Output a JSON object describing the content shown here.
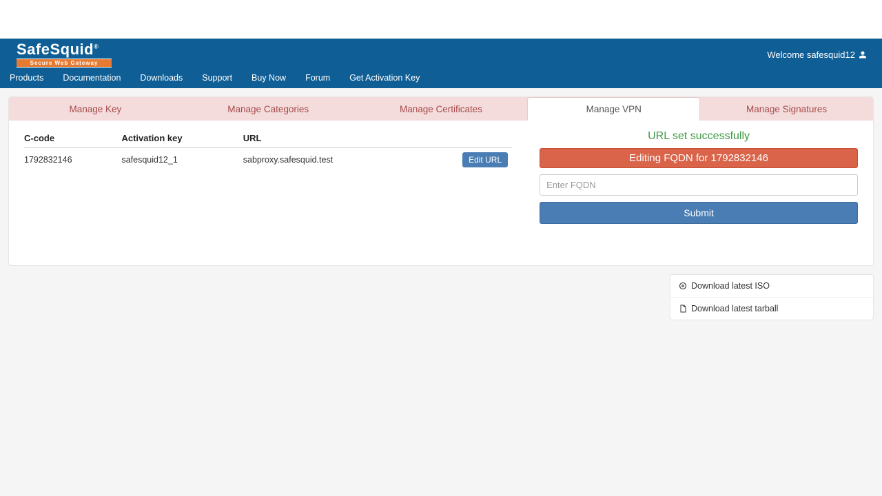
{
  "logo": {
    "main": "SafeSquid",
    "reg": "®",
    "sub": "Secure Web Gateway"
  },
  "welcome": "Welcome safesquid12",
  "nav": {
    "products": "Products",
    "documentation": "Documentation",
    "downloads": "Downloads",
    "support": "Support",
    "buy": "Buy Now",
    "forum": "Forum",
    "getkey": "Get Activation Key"
  },
  "tabs": {
    "key": "Manage Key",
    "categories": "Manage Categories",
    "certificates": "Manage Certificates",
    "vpn": "Manage VPN",
    "signatures": "Manage Signatures"
  },
  "table": {
    "headers": {
      "ccode": "C-code",
      "actkey": "Activation key",
      "url": "URL"
    },
    "row": {
      "ccode": "1792832146",
      "actkey": "safesquid12_1",
      "url": "sabproxy.safesquid.test",
      "edit": "Edit URL"
    }
  },
  "right": {
    "success": "URL set successfully",
    "banner": "Editing FQDN for 1792832146",
    "placeholder": "Enter FQDN",
    "submit": "Submit"
  },
  "downloads": {
    "iso": "Download latest ISO",
    "tarball": "Download latest tarball"
  }
}
